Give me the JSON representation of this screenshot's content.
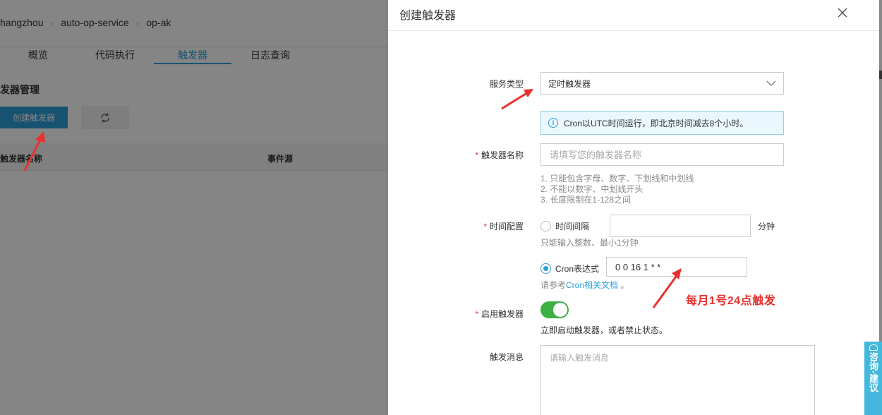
{
  "breadcrumb": [
    "hangzhou",
    "auto-op-service",
    "op-ak"
  ],
  "tabs": [
    {
      "label": "概览"
    },
    {
      "label": "代码执行"
    },
    {
      "label": "触发器",
      "active": true
    },
    {
      "label": "日志查询"
    }
  ],
  "page": {
    "section_title": "发器管理",
    "create_button": "创建触发器",
    "refresh_icon": "refresh-icon",
    "table_headers": [
      "触发器名称",
      "事件源"
    ]
  },
  "drawer": {
    "title": "创建触发器",
    "close_icon": "close-icon",
    "service_type": {
      "label": "服务类型",
      "value": "定时触发器"
    },
    "info_message": "Cron以UTC时间运行，即北京时间减去8个小时。",
    "trigger_name": {
      "label": "触发器名称",
      "placeholder": "请填写您的触发器名称",
      "rules": [
        "1. 只能包含字母、数字、下划线和中划线",
        "2. 不能以数字、中划线开头",
        "3. 长度限制在1-128之间"
      ]
    },
    "time_config": {
      "label": "时间配置",
      "interval_label": "时间间隔",
      "interval_value": "",
      "interval_unit": "分钟",
      "interval_hint": "只能输入整数、最小1分钟",
      "cron_label": "Cron表达式",
      "cron_value": "0 0 16 1 * *",
      "cron_hint_prefix": "请参考",
      "cron_hint_link": "Cron相关文档",
      "cron_hint_suffix": " 。",
      "selected": "cron"
    },
    "enable_trigger": {
      "label": "启用触发器",
      "enabled": true,
      "hint": "立即启动触发器，或者禁止状态。"
    },
    "trigger_message": {
      "label": "触发消息",
      "placeholder": "请输入触发消息"
    }
  },
  "annotation": "每月1号24点触发",
  "consult_button": "咨询·建议",
  "colors": {
    "accent": "#2d9fd8",
    "toggle_on": "#3cb043",
    "annotation": "#e8312f",
    "consult": "#44b8dc"
  }
}
